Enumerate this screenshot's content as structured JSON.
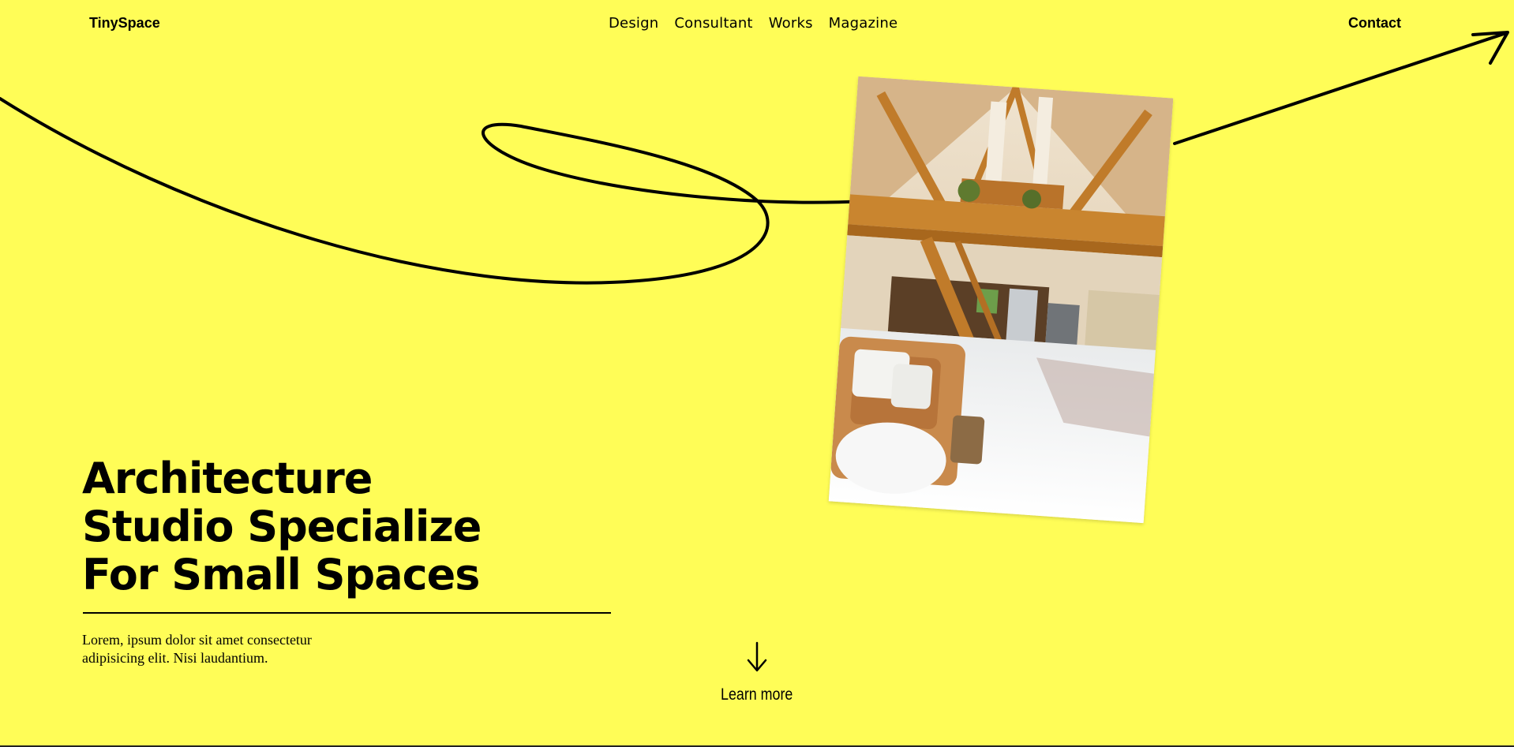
{
  "header": {
    "logo": "TinySpace",
    "nav": [
      "Design",
      "Consultant",
      "Works",
      "Magazine"
    ],
    "contact": "Contact"
  },
  "hero": {
    "headline": [
      "Architecture",
      "Studio Specialize",
      "For Small Spaces"
    ],
    "description": "Lorem, ipsum dolor sit amet consectetur adipisicing elit. Nisi laudantium.",
    "cta": "Learn more"
  },
  "colors": {
    "background": "#FFFD57",
    "text": "#000000"
  },
  "icons": {
    "swoosh": "curved-arrow-icon",
    "cta": "arrow-down-icon"
  }
}
